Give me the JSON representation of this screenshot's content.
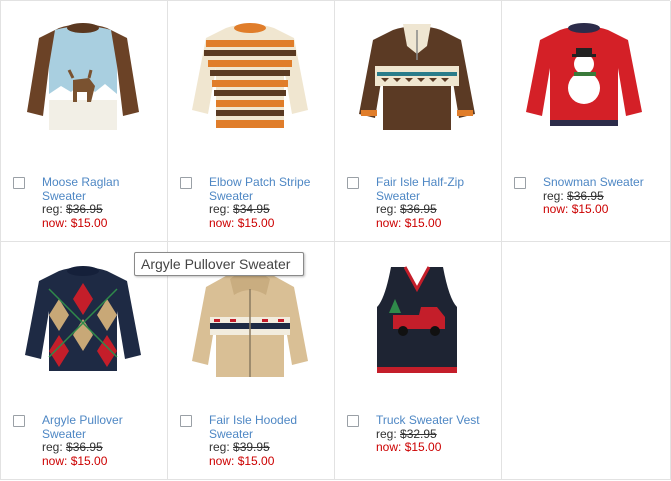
{
  "products": [
    {
      "name": "Moose Raglan Sweater",
      "name_line1": "Moose Raglan",
      "name_line2": "Sweater",
      "reg_label": "reg:",
      "reg_price": "$36.95",
      "now_label": "now:",
      "now_price": "$15.00",
      "icon": "moose-sweater-image"
    },
    {
      "name": "Elbow Patch Stripe Sweater",
      "name_line1": "Elbow Patch Stripe",
      "name_line2": "Sweater",
      "reg_label": "reg:",
      "reg_price": "$34.95",
      "now_label": "now:",
      "now_price": "$15.00",
      "icon": "stripe-sweater-image"
    },
    {
      "name": "Fair Isle Half-Zip Sweater",
      "name_line1": "Fair Isle Half-Zip",
      "name_line2": "Sweater",
      "reg_label": "reg:",
      "reg_price": "$36.95",
      "now_label": "now:",
      "now_price": "$15.00",
      "icon": "halfzip-sweater-image"
    },
    {
      "name": "Snowman Sweater",
      "name_line1": "Snowman Sweater",
      "name_line2": "",
      "reg_label": "reg:",
      "reg_price": "$36.95",
      "now_label": "now:",
      "now_price": "$15.00",
      "icon": "snowman-sweater-image"
    },
    {
      "name": "Argyle Pullover Sweater",
      "name_line1": "Argyle Pullover",
      "name_line2": "Sweater",
      "reg_label": "reg:",
      "reg_price": "$36.95",
      "now_label": "now:",
      "now_price": "$15.00",
      "icon": "argyle-sweater-image"
    },
    {
      "name": "Fair Isle Hooded Sweater",
      "name_line1": "Fair Isle Hooded",
      "name_line2": "Sweater",
      "reg_label": "reg:",
      "reg_price": "$39.95",
      "now_label": "now:",
      "now_price": "$15.00",
      "icon": "hooded-sweater-image"
    },
    {
      "name": "Truck Sweater Vest",
      "name_line1": "Truck Sweater Vest",
      "name_line2": "",
      "reg_label": "reg:",
      "reg_price": "$32.95",
      "now_label": "now:",
      "now_price": "$15.00",
      "icon": "truck-vest-image"
    }
  ],
  "tooltip": {
    "text": "Argyle Pullover Sweater"
  },
  "colors": {
    "link": "#4e87c4",
    "sale": "#cc0000",
    "border": "#e2e2e2"
  }
}
